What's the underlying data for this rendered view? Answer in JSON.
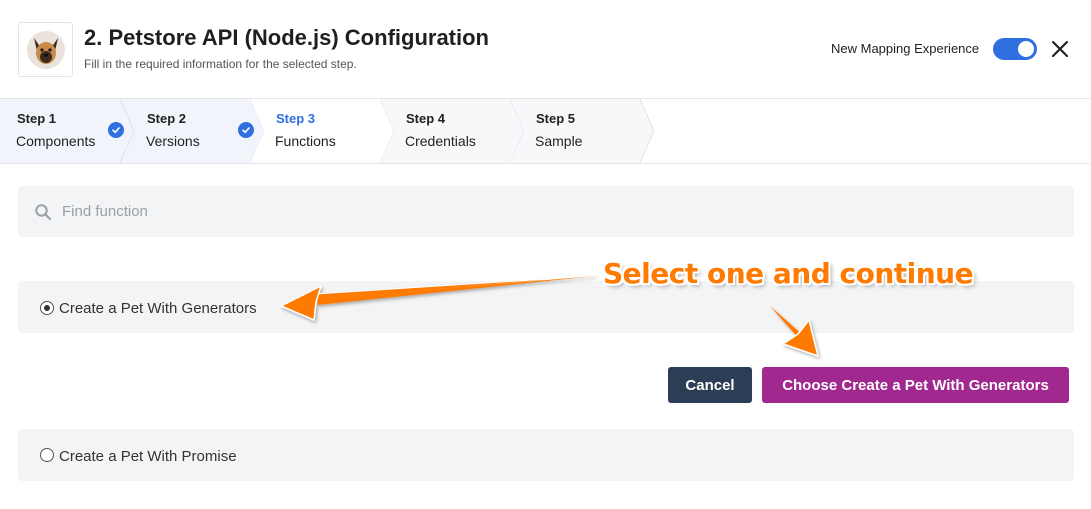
{
  "header": {
    "title": "2. Petstore API (Node.js) Configuration",
    "subtitle": "Fill in the required information for the selected step.",
    "toggle_label": "New Mapping Experience",
    "toggle_on": true
  },
  "steps": [
    {
      "number": "Step 1",
      "name": "Components",
      "state": "completed"
    },
    {
      "number": "Step 2",
      "name": "Versions",
      "state": "completed"
    },
    {
      "number": "Step 3",
      "name": "Functions",
      "state": "active"
    },
    {
      "number": "Step 4",
      "name": "Credentials",
      "state": "pending"
    },
    {
      "number": "Step 5",
      "name": "Sample",
      "state": "pending"
    }
  ],
  "search": {
    "placeholder": "Find function",
    "value": ""
  },
  "options": [
    {
      "label": "Create a Pet With Generators",
      "selected": true
    },
    {
      "label": "Create a Pet With Promise",
      "selected": false
    }
  ],
  "actions": {
    "cancel_label": "Cancel",
    "choose_label": "Choose Create a Pet With Generators"
  },
  "annotation": {
    "text": "Select one and continue",
    "color": "#ff7a00"
  },
  "colors": {
    "accent": "#2f6fe0",
    "primary_button": "#a0288f",
    "cancel_button": "#2c3e55",
    "panel_bg": "#f3f4f6"
  }
}
